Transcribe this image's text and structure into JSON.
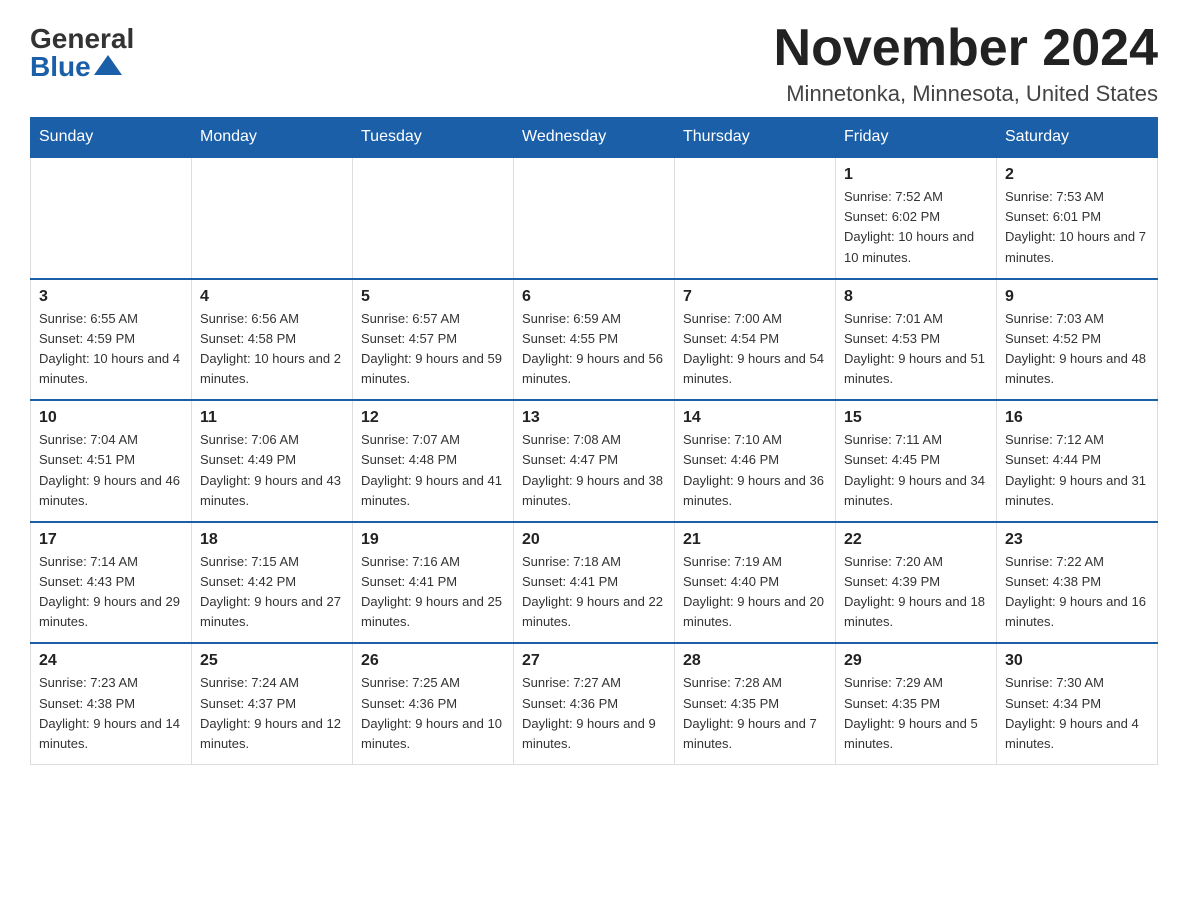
{
  "header": {
    "logo_general": "General",
    "logo_blue": "Blue",
    "month_title": "November 2024",
    "location": "Minnetonka, Minnesota, United States"
  },
  "days_of_week": [
    "Sunday",
    "Monday",
    "Tuesday",
    "Wednesday",
    "Thursday",
    "Friday",
    "Saturday"
  ],
  "weeks": [
    [
      {
        "day": "",
        "info": ""
      },
      {
        "day": "",
        "info": ""
      },
      {
        "day": "",
        "info": ""
      },
      {
        "day": "",
        "info": ""
      },
      {
        "day": "",
        "info": ""
      },
      {
        "day": "1",
        "info": "Sunrise: 7:52 AM\nSunset: 6:02 PM\nDaylight: 10 hours and 10 minutes."
      },
      {
        "day": "2",
        "info": "Sunrise: 7:53 AM\nSunset: 6:01 PM\nDaylight: 10 hours and 7 minutes."
      }
    ],
    [
      {
        "day": "3",
        "info": "Sunrise: 6:55 AM\nSunset: 4:59 PM\nDaylight: 10 hours and 4 minutes."
      },
      {
        "day": "4",
        "info": "Sunrise: 6:56 AM\nSunset: 4:58 PM\nDaylight: 10 hours and 2 minutes."
      },
      {
        "day": "5",
        "info": "Sunrise: 6:57 AM\nSunset: 4:57 PM\nDaylight: 9 hours and 59 minutes."
      },
      {
        "day": "6",
        "info": "Sunrise: 6:59 AM\nSunset: 4:55 PM\nDaylight: 9 hours and 56 minutes."
      },
      {
        "day": "7",
        "info": "Sunrise: 7:00 AM\nSunset: 4:54 PM\nDaylight: 9 hours and 54 minutes."
      },
      {
        "day": "8",
        "info": "Sunrise: 7:01 AM\nSunset: 4:53 PM\nDaylight: 9 hours and 51 minutes."
      },
      {
        "day": "9",
        "info": "Sunrise: 7:03 AM\nSunset: 4:52 PM\nDaylight: 9 hours and 48 minutes."
      }
    ],
    [
      {
        "day": "10",
        "info": "Sunrise: 7:04 AM\nSunset: 4:51 PM\nDaylight: 9 hours and 46 minutes."
      },
      {
        "day": "11",
        "info": "Sunrise: 7:06 AM\nSunset: 4:49 PM\nDaylight: 9 hours and 43 minutes."
      },
      {
        "day": "12",
        "info": "Sunrise: 7:07 AM\nSunset: 4:48 PM\nDaylight: 9 hours and 41 minutes."
      },
      {
        "day": "13",
        "info": "Sunrise: 7:08 AM\nSunset: 4:47 PM\nDaylight: 9 hours and 38 minutes."
      },
      {
        "day": "14",
        "info": "Sunrise: 7:10 AM\nSunset: 4:46 PM\nDaylight: 9 hours and 36 minutes."
      },
      {
        "day": "15",
        "info": "Sunrise: 7:11 AM\nSunset: 4:45 PM\nDaylight: 9 hours and 34 minutes."
      },
      {
        "day": "16",
        "info": "Sunrise: 7:12 AM\nSunset: 4:44 PM\nDaylight: 9 hours and 31 minutes."
      }
    ],
    [
      {
        "day": "17",
        "info": "Sunrise: 7:14 AM\nSunset: 4:43 PM\nDaylight: 9 hours and 29 minutes."
      },
      {
        "day": "18",
        "info": "Sunrise: 7:15 AM\nSunset: 4:42 PM\nDaylight: 9 hours and 27 minutes."
      },
      {
        "day": "19",
        "info": "Sunrise: 7:16 AM\nSunset: 4:41 PM\nDaylight: 9 hours and 25 minutes."
      },
      {
        "day": "20",
        "info": "Sunrise: 7:18 AM\nSunset: 4:41 PM\nDaylight: 9 hours and 22 minutes."
      },
      {
        "day": "21",
        "info": "Sunrise: 7:19 AM\nSunset: 4:40 PM\nDaylight: 9 hours and 20 minutes."
      },
      {
        "day": "22",
        "info": "Sunrise: 7:20 AM\nSunset: 4:39 PM\nDaylight: 9 hours and 18 minutes."
      },
      {
        "day": "23",
        "info": "Sunrise: 7:22 AM\nSunset: 4:38 PM\nDaylight: 9 hours and 16 minutes."
      }
    ],
    [
      {
        "day": "24",
        "info": "Sunrise: 7:23 AM\nSunset: 4:38 PM\nDaylight: 9 hours and 14 minutes."
      },
      {
        "day": "25",
        "info": "Sunrise: 7:24 AM\nSunset: 4:37 PM\nDaylight: 9 hours and 12 minutes."
      },
      {
        "day": "26",
        "info": "Sunrise: 7:25 AM\nSunset: 4:36 PM\nDaylight: 9 hours and 10 minutes."
      },
      {
        "day": "27",
        "info": "Sunrise: 7:27 AM\nSunset: 4:36 PM\nDaylight: 9 hours and 9 minutes."
      },
      {
        "day": "28",
        "info": "Sunrise: 7:28 AM\nSunset: 4:35 PM\nDaylight: 9 hours and 7 minutes."
      },
      {
        "day": "29",
        "info": "Sunrise: 7:29 AM\nSunset: 4:35 PM\nDaylight: 9 hours and 5 minutes."
      },
      {
        "day": "30",
        "info": "Sunrise: 7:30 AM\nSunset: 4:34 PM\nDaylight: 9 hours and 4 minutes."
      }
    ]
  ]
}
